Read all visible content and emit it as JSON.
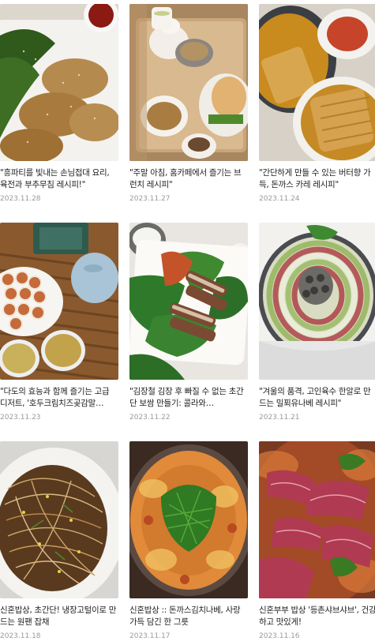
{
  "posts": [
    {
      "title": "\"흥파티를 빛내는 손님접대 요리, 육전과 부추무침 레시피!\"",
      "date": "2023.11.28",
      "image": "육전과 부추무침 사진"
    },
    {
      "title": "\"주말 아침, 홈카페에서 즐기는 브런치 레시피\"",
      "date": "2023.11.27",
      "image": "브런치 사진"
    },
    {
      "title": "\"간단하게 만들 수 있는 버터향 가득, 돈까스 카레 레시피\"",
      "date": "2023.11.24",
      "image": "돈까스 카레 사진"
    },
    {
      "title": "\"다도의 효능과 함께 즐기는 고급 디저트, '호두크림치즈곶감말…",
      "date": "2023.11.23",
      "image": "곶감말이 디저트 사진"
    },
    {
      "title": "\"김장철 김장 후 빠질 수 없는 초간단 보쌈 만들기: 콜라와…",
      "date": "2023.11.22",
      "image": "보쌈 사진"
    },
    {
      "title": "\"겨울의 품격, 고인육수 한알로 만드는 밀푀유나베 레시피\"",
      "date": "2023.11.21",
      "image": "밀푀유나베 사진"
    },
    {
      "title": "신혼밥상, 초간단! 냉장고털이로 만드는 원팬 잡채",
      "date": "2023.11.18",
      "image": "원팬 잡채 사진"
    },
    {
      "title": "신혼밥상 :: 돈까스김치나베, 사랑 가득 담긴 한 그릇",
      "date": "2023.11.17",
      "image": "돈까스김치나베 사진"
    },
    {
      "title": "신혼부부 밥상 '등촌샤브샤브', 건강하고 맛있게!",
      "date": "2023.11.16",
      "image": "등촌샤브샤브 사진"
    }
  ]
}
